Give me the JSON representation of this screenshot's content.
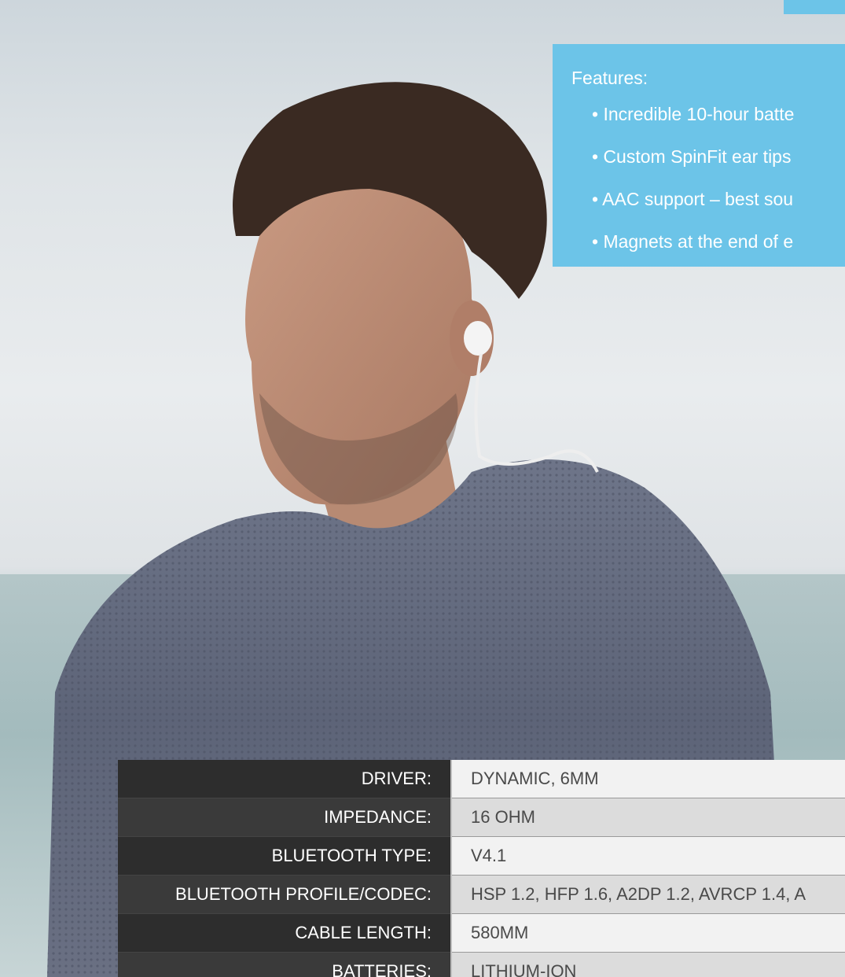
{
  "features": {
    "title": "Features:",
    "items": [
      "• Incredible 10-hour batte",
      "• Custom SpinFit ear tips",
      "• AAC support – best sou",
      "• Magnets at the end of e"
    ]
  },
  "specs": [
    {
      "label": "DRIVER:",
      "value": "DYNAMIC, 6MM"
    },
    {
      "label": "IMPEDANCE:",
      "value": "16 OHM"
    },
    {
      "label": "BLUETOOTH TYPE:",
      "value": "V4.1"
    },
    {
      "label": "BLUETOOTH PROFILE/CODEC:",
      "value": "HSP 1.2, HFP 1.6, A2DP 1.2, AVRCP 1.4, A"
    },
    {
      "label": "CABLE LENGTH:",
      "value": "580MM"
    },
    {
      "label": "BATTERIES:",
      "value": "LITHIUM-ION"
    }
  ],
  "colors": {
    "accent": "#6cc4e8",
    "label_bg": "#2d2d2d",
    "value_bg": "#f2f2f2"
  }
}
